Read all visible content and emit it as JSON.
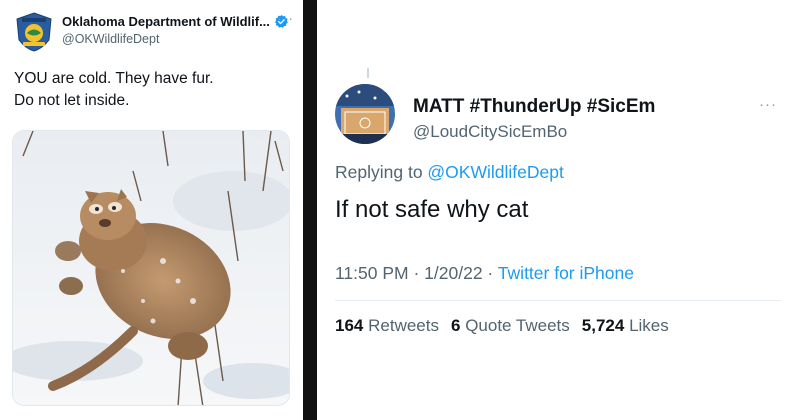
{
  "left_tweet": {
    "author_name": "Oklahoma Department of Wildlif...",
    "author_handle": "@OKWildlifeDept",
    "more_label": "···",
    "text_lines": [
      "YOU are cold. They have fur.",
      "Do not let inside."
    ],
    "avatar_icon": "okdwc-badge-logo",
    "verified_icon": "verified-badge-icon",
    "photo_subject": "mountain-lion-rolling-in-snow"
  },
  "right_tweet": {
    "author_name": "MATT #ThunderUp #SicEm",
    "author_handle": "@LoudCitySicEmBo",
    "more_label": "···",
    "replying_prefix": "Replying to ",
    "replying_to": "@OKWildlifeDept",
    "text": "If not safe why cat",
    "time": "11:50 PM",
    "date": "1/20/22",
    "meta_dot": " · ",
    "source": "Twitter for iPhone",
    "retweets_count": "164",
    "retweets_label": "Retweets",
    "quotes_count": "6",
    "quotes_label": "Quote Tweets",
    "likes_count": "5,724",
    "likes_label": "Likes"
  },
  "colors": {
    "link_blue": "#1d9bf0",
    "text_primary": "#0f1419",
    "text_secondary": "#536471",
    "divider": "#111111"
  }
}
